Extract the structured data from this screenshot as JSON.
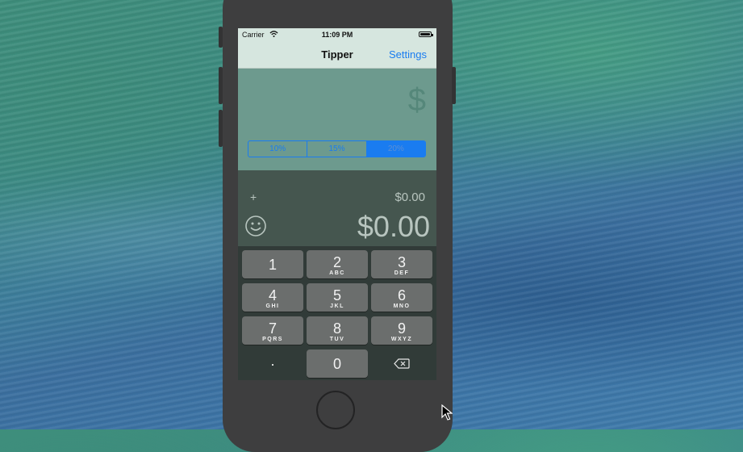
{
  "status_bar": {
    "carrier": "Carrier",
    "time": "11:09 PM"
  },
  "nav": {
    "title": "Tipper",
    "settings_label": "Settings"
  },
  "bill_input": {
    "placeholder_symbol": "$"
  },
  "tip_segments": {
    "options": [
      "10%",
      "15%",
      "20%"
    ],
    "selected": "20%"
  },
  "results": {
    "plus_sign": "+",
    "tip_amount": "$0.00",
    "total": "$0.00"
  },
  "keypad": {
    "keys": [
      {
        "num": "1",
        "letters": ""
      },
      {
        "num": "2",
        "letters": "ABC"
      },
      {
        "num": "3",
        "letters": "DEF"
      },
      {
        "num": "4",
        "letters": "GHI"
      },
      {
        "num": "5",
        "letters": "JKL"
      },
      {
        "num": "6",
        "letters": "MNO"
      },
      {
        "num": "7",
        "letters": "PQRS"
      },
      {
        "num": "8",
        "letters": "TUV"
      },
      {
        "num": "9",
        "letters": "WXYZ"
      }
    ],
    "decimal": ".",
    "zero": "0"
  },
  "icons": {
    "wifi": "wifi-icon",
    "battery": "battery-icon",
    "smiley": "smiley-icon",
    "backspace": "backspace-icon",
    "cursor": "mouse-pointer-icon"
  },
  "colors": {
    "accent": "#1a7cf0",
    "nav_bg": "#d6e6df",
    "top_area_bg": "#6d9a8e",
    "result_bg": "#45564f",
    "key_bg": "#6b6e6d"
  }
}
